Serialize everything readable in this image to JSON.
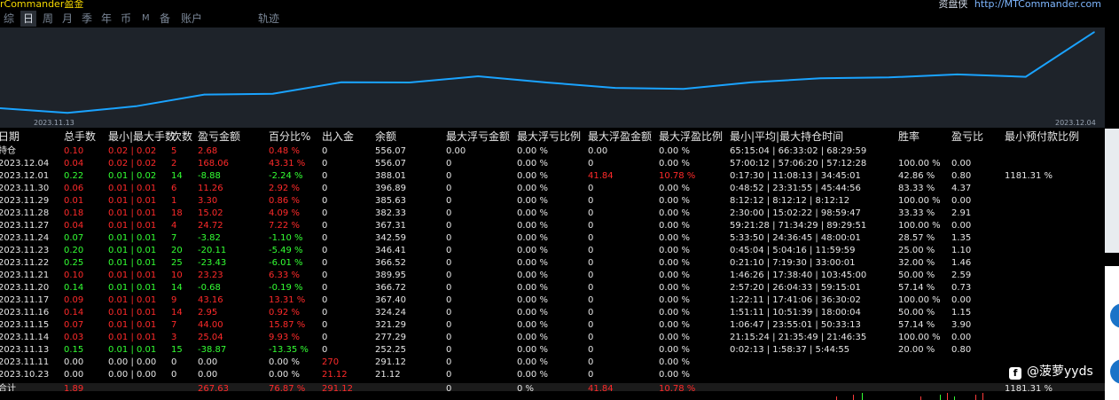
{
  "header": {
    "app_title": "rCommander盈金",
    "right_label": "资盘侠",
    "right_link": "http://MTCommander.com"
  },
  "tabs": [
    {
      "label": "综",
      "active": false
    },
    {
      "label": "日",
      "active": true
    },
    {
      "label": "周",
      "active": false
    },
    {
      "label": "月",
      "active": false
    },
    {
      "label": "季",
      "active": false
    },
    {
      "label": "年",
      "active": false
    },
    {
      "label": "币",
      "active": false
    },
    {
      "label": "M",
      "active": false
    },
    {
      "label": "备",
      "active": false
    },
    {
      "label": "账户",
      "active": false
    },
    {
      "label": "轨迹",
      "active": false
    }
  ],
  "chart_data": {
    "type": "line",
    "x_start_label": "2023.11.13",
    "x_end_label": "2023.12.04",
    "x": [
      "2023.11.13",
      "2023.11.14",
      "2023.11.15",
      "2023.11.16",
      "2023.11.17",
      "2023.11.20",
      "2023.11.21",
      "2023.11.22",
      "2023.11.23",
      "2023.11.24",
      "2023.11.27",
      "2023.11.28",
      "2023.11.29",
      "2023.11.30",
      "2023.12.01",
      "2023.12.04"
    ],
    "series": [
      {
        "values": [
          252.25,
          277.29,
          321.29,
          324.24,
          367.4,
          366.72,
          389.95,
          366.52,
          346.41,
          342.59,
          367.31,
          382.33,
          385.63,
          396.89,
          388.01,
          556.07
        ]
      }
    ],
    "ylim": [
      210,
      560
    ],
    "color": "#1aa3ff",
    "background": "#1e232a"
  },
  "table": {
    "columns": [
      "日期",
      "总手数",
      "最小|最大手数",
      "次数",
      "盈亏金额",
      "百分比%",
      "出入金",
      "余额",
      "最大浮亏金额",
      "最大浮亏比例",
      "最大浮盈金额",
      "最大浮盈比例",
      "最小|平均|最大持仓时间",
      "胜率",
      "盈亏比",
      "最小预付款比例"
    ],
    "rows": [
      [
        "持仓",
        "0.10",
        "0.02 | 0.02",
        "5",
        "2.68",
        "0.48 %",
        "0",
        "556.07",
        "0.00",
        "0.00 %",
        "0.00",
        "0.00 %",
        "65:15:04 | 66:33:02 | 68:29:59",
        "",
        "",
        ""
      ],
      [
        "2023.12.04",
        "0.04",
        "0.02 | 0.02",
        "2",
        "168.06",
        "43.31 %",
        "0",
        "556.07",
        "0",
        "0.00 %",
        "0",
        "0.00 %",
        "57:00:12 | 57:06:20 | 57:12:28",
        "100.00 %",
        "0.00",
        ""
      ],
      [
        "2023.12.01",
        "0.22",
        "0.01 | 0.02",
        "14",
        "-8.88",
        "-2.24 %",
        "0",
        "388.01",
        "0",
        "0.00 %",
        "41.84",
        "10.78 %",
        "0:17:30 | 11:08:13 | 34:45:01",
        "42.86 %",
        "0.80",
        "1181.31 %"
      ],
      [
        "2023.11.30",
        "0.06",
        "0.01 | 0.01",
        "6",
        "11.26",
        "2.92 %",
        "0",
        "396.89",
        "0",
        "0.00 %",
        "0",
        "0.00 %",
        "0:48:52 | 23:31:55 | 45:44:56",
        "83.33 %",
        "4.37",
        ""
      ],
      [
        "2023.11.29",
        "0.01",
        "0.01 | 0.01",
        "1",
        "3.30",
        "0.86 %",
        "0",
        "385.63",
        "0",
        "0.00 %",
        "0",
        "0.00 %",
        "8:12:12 | 8:12:12 | 8:12:12",
        "100.00 %",
        "0.00",
        ""
      ],
      [
        "2023.11.28",
        "0.18",
        "0.01 | 0.01",
        "18",
        "15.02",
        "4.09 %",
        "0",
        "382.33",
        "0",
        "0.00 %",
        "0",
        "0.00 %",
        "2:30:00 | 15:02:22 | 98:59:47",
        "33.33 %",
        "2.91",
        ""
      ],
      [
        "2023.11.27",
        "0.04",
        "0.01 | 0.01",
        "4",
        "24.72",
        "7.22 %",
        "0",
        "367.31",
        "0",
        "0.00 %",
        "0",
        "0.00 %",
        "59:21:28 | 71:34:29 | 89:29:51",
        "100.00 %",
        "0.00",
        ""
      ],
      [
        "2023.11.24",
        "0.07",
        "0.01 | 0.01",
        "7",
        "-3.82",
        "-1.10 %",
        "0",
        "342.59",
        "0",
        "0.00 %",
        "0",
        "0.00 %",
        "5:33:50 | 24:36:45 | 48:00:01",
        "28.57 %",
        "1.35",
        ""
      ],
      [
        "2023.11.23",
        "0.20",
        "0.01 | 0.01",
        "20",
        "-20.11",
        "-5.49 %",
        "0",
        "346.41",
        "0",
        "0.00 %",
        "0",
        "0.00 %",
        "0:45:04 | 5:04:16 | 11:59:59",
        "25.00 %",
        "1.10",
        ""
      ],
      [
        "2023.11.22",
        "0.25",
        "0.01 | 0.01",
        "25",
        "-23.43",
        "-6.01 %",
        "0",
        "366.52",
        "0",
        "0.00 %",
        "0",
        "0.00 %",
        "0:21:10 | 7:19:30 | 33:00:01",
        "32.00 %",
        "1.46",
        ""
      ],
      [
        "2023.11.21",
        "0.10",
        "0.01 | 0.01",
        "10",
        "23.23",
        "6.33 %",
        "0",
        "389.95",
        "0",
        "0.00 %",
        "0",
        "0.00 %",
        "1:46:26 | 17:38:40 | 103:45:00",
        "50.00 %",
        "2.59",
        ""
      ],
      [
        "2023.11.20",
        "0.14",
        "0.01 | 0.01",
        "14",
        "-0.68",
        "-0.19 %",
        "0",
        "366.72",
        "0",
        "0.00 %",
        "0",
        "0.00 %",
        "2:57:20 | 26:04:33 | 59:15:01",
        "57.14 %",
        "0.73",
        ""
      ],
      [
        "2023.11.17",
        "0.09",
        "0.01 | 0.01",
        "9",
        "43.16",
        "13.31 %",
        "0",
        "367.40",
        "0",
        "0.00 %",
        "0",
        "0.00 %",
        "1:22:11 | 17:41:06 | 36:30:02",
        "100.00 %",
        "0.00",
        ""
      ],
      [
        "2023.11.16",
        "0.14",
        "0.01 | 0.01",
        "14",
        "2.95",
        "0.92 %",
        "0",
        "324.24",
        "0",
        "0.00 %",
        "0",
        "0.00 %",
        "1:51:11 | 10:51:39 | 18:00:04",
        "50.00 %",
        "1.15",
        ""
      ],
      [
        "2023.11.15",
        "0.07",
        "0.01 | 0.01",
        "7",
        "44.00",
        "15.87 %",
        "0",
        "321.29",
        "0",
        "0.00 %",
        "0",
        "0.00 %",
        "1:06:47 | 23:55:01 | 50:33:13",
        "57.14 %",
        "3.90",
        ""
      ],
      [
        "2023.11.14",
        "0.03",
        "0.01 | 0.01",
        "3",
        "25.04",
        "9.93 %",
        "0",
        "277.29",
        "0",
        "0.00 %",
        "0",
        "0.00 %",
        "21:15:24 | 21:35:49 | 21:46:35",
        "100.00 %",
        "0.00",
        ""
      ],
      [
        "2023.11.13",
        "0.15",
        "0.01 | 0.01",
        "15",
        "-38.87",
        "-13.35 %",
        "0",
        "252.25",
        "0",
        "0.00 %",
        "0",
        "0.00 %",
        "0:02:13 | 1:58:37 | 5:44:55",
        "20.00 %",
        "0.80",
        ""
      ],
      [
        "2023.11.11",
        "0.00",
        "0.00 | 0.00",
        "0",
        "0.00",
        "0.00 %",
        "270",
        "291.12",
        "0",
        "0.00 %",
        "0",
        "0.00 %",
        "",
        "",
        "",
        ""
      ],
      [
        "2023.10.23",
        "0.00",
        "0.00 | 0.00",
        "0",
        "0.00",
        "0.00 %",
        "21.12",
        "21.12",
        "0",
        "0.00 %",
        "0",
        "0.00 %",
        "",
        "",
        "",
        ""
      ]
    ],
    "row_colors": [
      "red",
      "red",
      "green",
      "red",
      "red",
      "red",
      "red",
      "green",
      "green",
      "green",
      "red",
      "green",
      "red",
      "red",
      "red",
      "red",
      "green",
      "white",
      "white"
    ],
    "total": [
      "合计",
      "1.89",
      "",
      "",
      "267.63",
      "76.87 %",
      "291.12",
      "",
      "0",
      "0 %",
      "41.84",
      "10.78 %",
      "",
      "",
      "",
      "1181.31 %"
    ]
  },
  "colors": {
    "red": "#ff2a2a",
    "green": "#33ff33",
    "white": "#e6e6e6",
    "gold": "#f5d800",
    "line": "#1aa3ff"
  },
  "watermark": {
    "icon": "f",
    "text": "@菠萝yyds"
  }
}
